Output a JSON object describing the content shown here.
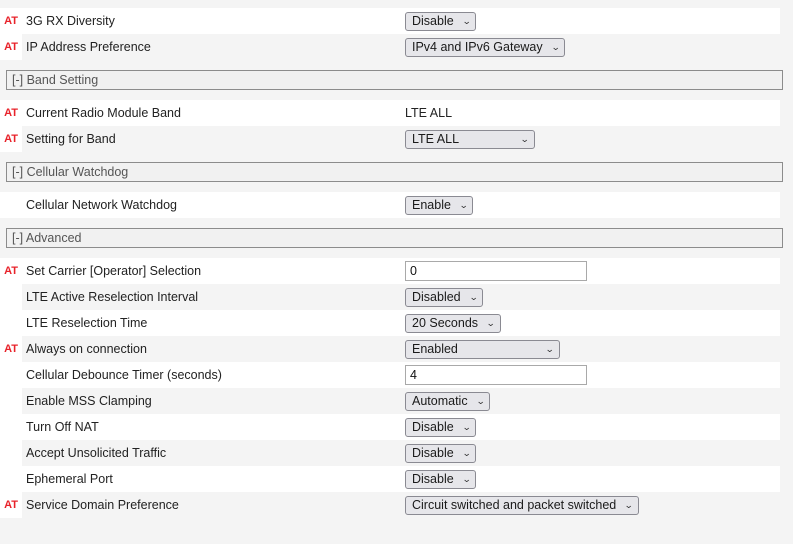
{
  "page": {
    "background": "#f4f4f4",
    "at_badge_text": "AT",
    "at_badge_color": "#e8222a"
  },
  "icons": {
    "chevron_down": "⌄"
  },
  "top_rows": [
    {
      "at": true,
      "label": "3G RX Diversity",
      "control": "select",
      "value": "Disable",
      "width_class": "w-disable"
    },
    {
      "at": true,
      "label": "IP Address Preference",
      "control": "select",
      "value": "IPv4 and IPv6 Gateway",
      "width_class": "w-ipv"
    }
  ],
  "sections": [
    {
      "id": "band-setting",
      "header": "[-] Band Setting",
      "rows": [
        {
          "at": true,
          "label": "Current Radio Module Band",
          "control": "text",
          "value": "LTE ALL",
          "width_class": ""
        },
        {
          "at": true,
          "label": "Setting for Band",
          "control": "select",
          "value": "LTE ALL",
          "width_class": "w-lteall"
        }
      ]
    },
    {
      "id": "cellular-watchdog",
      "header": "[-] Cellular Watchdog",
      "rows": [
        {
          "at": false,
          "label": "Cellular Network Watchdog",
          "control": "select",
          "value": "Enable",
          "width_class": "w-enable"
        }
      ]
    },
    {
      "id": "advanced",
      "header": "[-] Advanced",
      "rows": [
        {
          "at": true,
          "label": "Set Carrier [Operator] Selection",
          "control": "input",
          "value": "0",
          "width_class": ""
        },
        {
          "at": false,
          "label": "LTE Active Reselection Interval",
          "control": "select",
          "value": "Disabled",
          "width_class": "w-disabled"
        },
        {
          "at": false,
          "label": "LTE Reselection Time",
          "control": "select",
          "value": "20 Seconds",
          "width_class": "w-20s"
        },
        {
          "at": true,
          "label": "Always on connection",
          "control": "select",
          "value": "Enabled",
          "width_class": "w-enabled"
        },
        {
          "at": false,
          "label": "Cellular Debounce Timer (seconds)",
          "control": "input",
          "value": "4",
          "width_class": ""
        },
        {
          "at": false,
          "label": "Enable MSS Clamping",
          "control": "select",
          "value": "Automatic",
          "width_class": "w-automatic"
        },
        {
          "at": false,
          "label": "Turn Off NAT",
          "control": "select",
          "value": "Disable",
          "width_class": "w-disable"
        },
        {
          "at": false,
          "label": "Accept Unsolicited Traffic",
          "control": "select",
          "value": "Disable",
          "width_class": "w-disable"
        },
        {
          "at": false,
          "label": "Ephemeral Port",
          "control": "select",
          "value": "Disable",
          "width_class": "w-disable"
        },
        {
          "at": true,
          "label": "Service Domain Preference",
          "control": "select",
          "value": "Circuit switched and packet switched",
          "width_class": "w-circuit"
        }
      ]
    }
  ]
}
